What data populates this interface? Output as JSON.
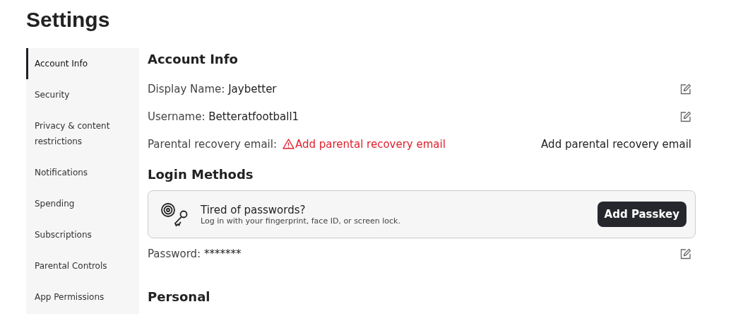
{
  "page_title": "Settings",
  "sidebar": {
    "items": [
      {
        "label": "Account Info",
        "selected": true
      },
      {
        "label": "Security",
        "selected": false
      },
      {
        "label": "Privacy & content restrictions",
        "selected": false
      },
      {
        "label": "Notifications",
        "selected": false
      },
      {
        "label": "Spending",
        "selected": false
      },
      {
        "label": "Subscriptions",
        "selected": false
      },
      {
        "label": "Parental Controls",
        "selected": false
      },
      {
        "label": "App Permissions",
        "selected": false
      }
    ]
  },
  "account_info": {
    "heading": "Account Info",
    "fields": [
      {
        "kind": "editable",
        "label": "Display Name:",
        "value": "Jaybetter"
      },
      {
        "kind": "editable",
        "label": "Username:",
        "value": "Betteratfootball1"
      },
      {
        "kind": "warning",
        "label": "Parental recovery email:",
        "value": "Add parental recovery email",
        "action": "Add parental recovery email"
      }
    ]
  },
  "login_methods": {
    "heading": "Login Methods",
    "passkey_card": {
      "title": "Tired of passwords?",
      "subtitle": "Log in with your fingerprint, face ID, or screen lock.",
      "button": "Add Passkey"
    },
    "fields": [
      {
        "kind": "editable",
        "label": "Password:",
        "value": "*******"
      }
    ]
  },
  "personal": {
    "heading": "Personal"
  }
}
